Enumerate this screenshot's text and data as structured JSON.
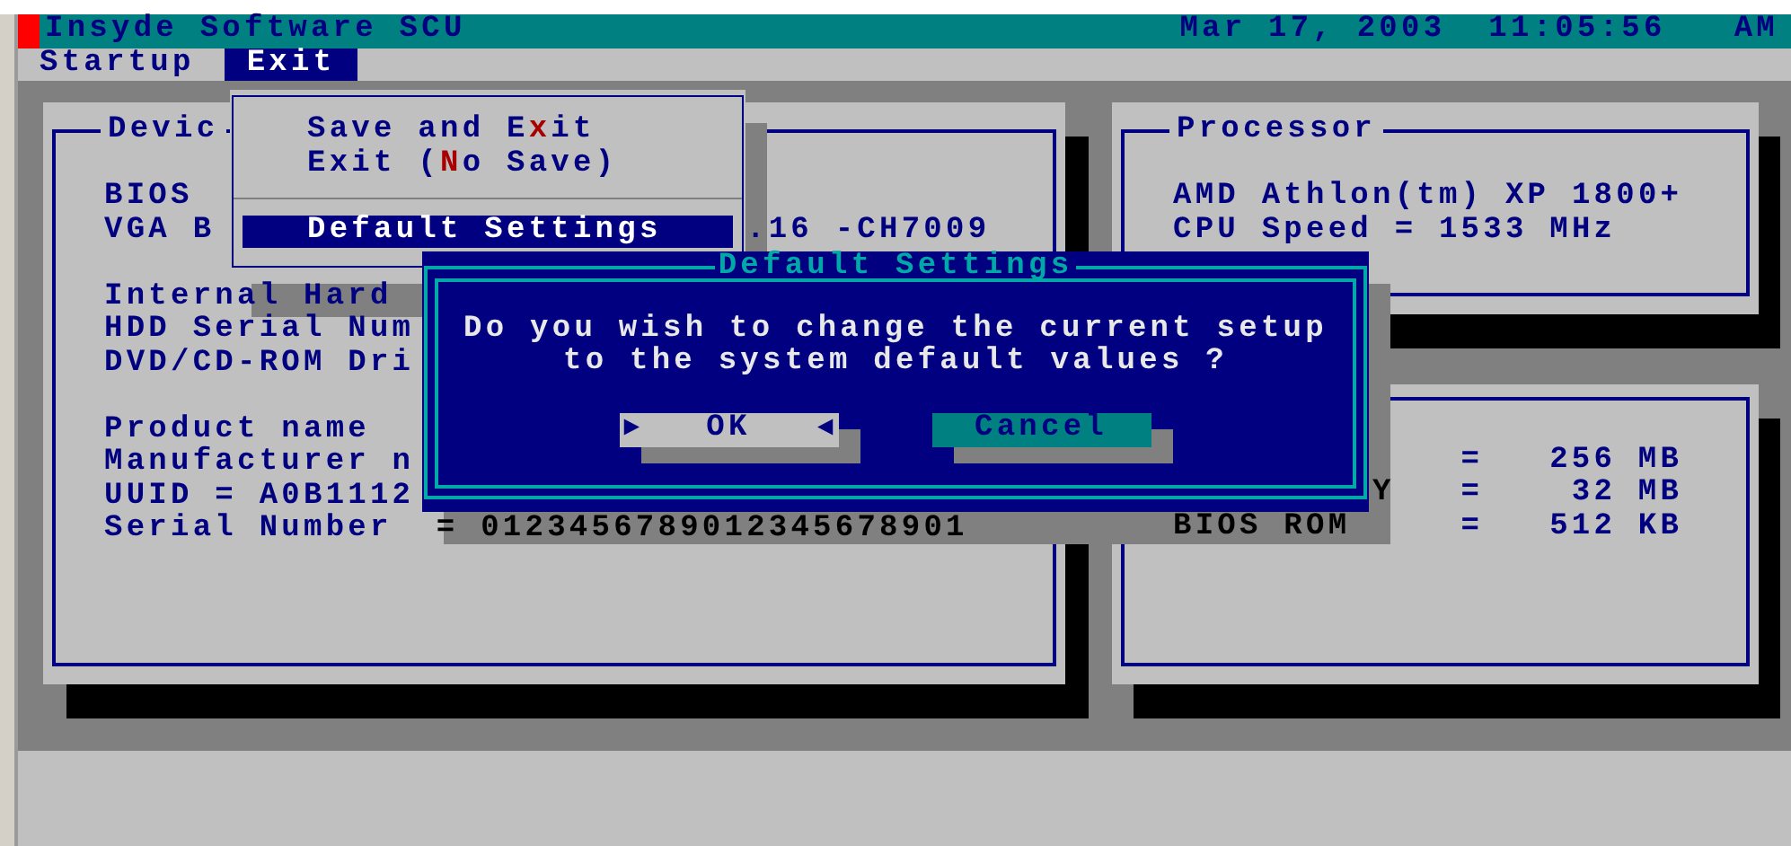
{
  "title_bar": {
    "title": "Insyde Software SCU",
    "date": "Mar 17, 2003",
    "time": "11:05:56",
    "meridiem": "AM"
  },
  "menu_bar": [
    {
      "label": "Startup",
      "selected": false
    },
    {
      "label": "Exit",
      "selected": true
    }
  ],
  "device_panel": {
    "title": "Devic",
    "groups": [
      [
        {
          "label": "BIOS"
        },
        {
          "label": "VGA B",
          "value": ".16 -CH7009",
          "value_shaded": false
        }
      ],
      [
        {
          "label": "Internal Hard"
        },
        {
          "label": "HDD Serial Num"
        },
        {
          "label": "DVD/CD-ROM Dri"
        }
      ],
      [
        {
          "label": "Product name"
        },
        {
          "label": "Manufacturer n"
        },
        {
          "label": "UUID = A0B1112"
        },
        {
          "label": "Serial Number",
          "value": "= 0123456789012345678901",
          "value_shaded": true
        }
      ]
    ]
  },
  "processor_panel": {
    "title": "Processor",
    "lines": [
      "AMD Athlon(tm) XP 1800+",
      "CPU Speed = 1533 MHz"
    ]
  },
  "memory_panel": {
    "rows": [
      {
        "operator": "=",
        "amount": "256",
        "unit": "MB"
      },
      {
        "label": "Y",
        "label_shaded": true,
        "operator": "=",
        "amount": "32",
        "unit": "MB"
      },
      {
        "label": "BIOS ROM",
        "label_shaded": true,
        "operator": "=",
        "amount": "512",
        "unit": "KB"
      }
    ]
  },
  "exit_menu": {
    "items": [
      {
        "kind": "item",
        "parts": [
          "Save and E",
          "x",
          "it"
        ],
        "selected": false
      },
      {
        "kind": "item",
        "parts": [
          "Exit (",
          "N",
          "o Save)"
        ],
        "selected": false
      },
      {
        "kind": "separator"
      },
      {
        "kind": "item",
        "parts": [
          "Default Settings"
        ],
        "selected": true
      }
    ]
  },
  "dialog": {
    "title": "Default Settings",
    "message": [
      "Do you wish to change the current setup",
      "to the system default values ?"
    ],
    "buttons": [
      {
        "label": "OK",
        "selected": true,
        "markers": [
          "►",
          "◄"
        ]
      },
      {
        "label": "Cancel",
        "selected": false
      }
    ]
  }
}
